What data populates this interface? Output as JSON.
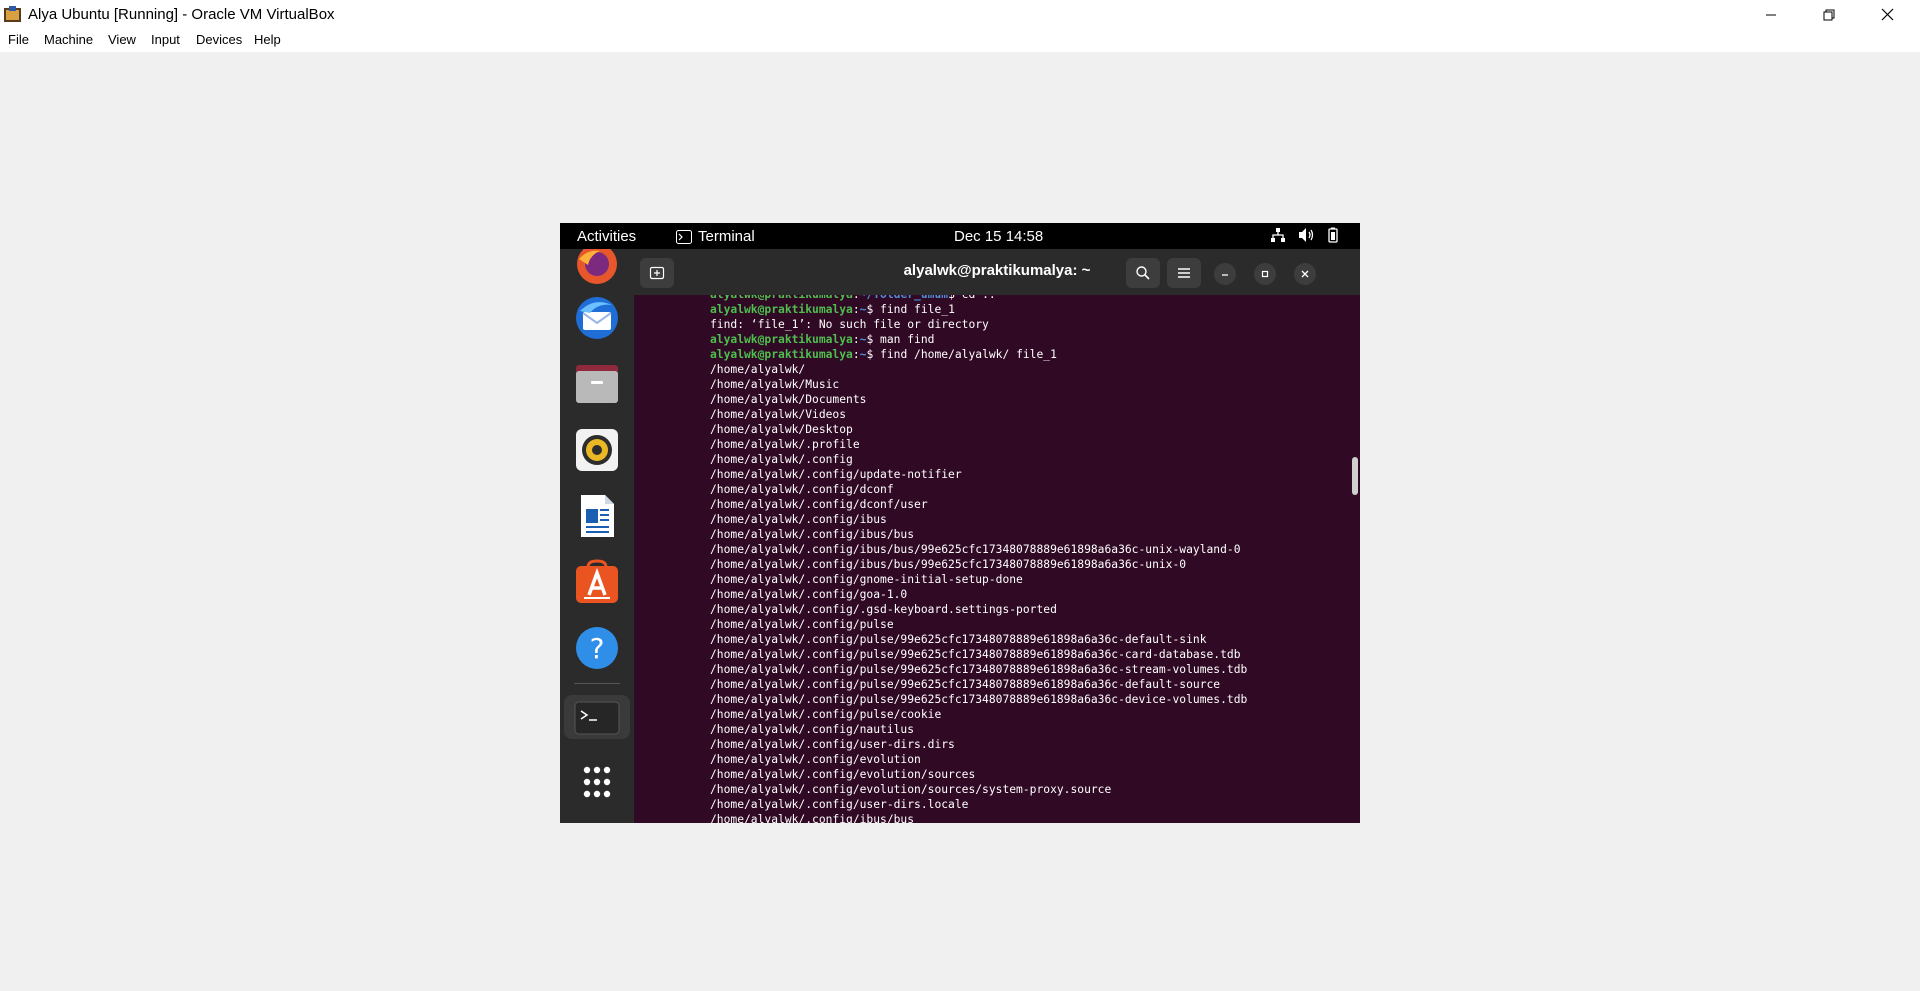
{
  "window": {
    "title": "Alya Ubuntu [Running] - Oracle VM VirtualBox",
    "controls": {
      "minimize_icon": "minimize-icon",
      "restore_icon": "restore-icon",
      "close_icon": "close-icon"
    }
  },
  "menubar": {
    "items": [
      "File",
      "Machine",
      "View",
      "Input",
      "Devices",
      "Help"
    ]
  },
  "ubuntu": {
    "activities": "Activities",
    "app_name": "Terminal",
    "clock": "Dec 15  14:58",
    "tray_icons": [
      "network-icon",
      "volume-icon",
      "battery-icon"
    ]
  },
  "dock": {
    "apps": [
      "firefox-icon",
      "thunderbird-icon",
      "files-icon",
      "rhythmbox-icon",
      "libreoffice-writer-icon",
      "app-center-icon",
      "help-icon",
      "terminal-icon",
      "show-apps-icon"
    ]
  },
  "terminal": {
    "title": "alyalwk@praktikumalya: ~",
    "header_icons": [
      "new-tab-icon",
      "search-icon",
      "hamburger-menu-icon",
      "minimize-icon",
      "maximize-icon",
      "close-icon"
    ],
    "lines": [
      {
        "user": "alyalwk@praktikumalya",
        "path": "~/folder_umum",
        "text": "$ cd .."
      },
      {
        "user": "alyalwk@praktikumalya",
        "path": "~",
        "text": "$ find file_1"
      },
      {
        "text": "find: ‘file_1’: No such file or directory"
      },
      {
        "user": "alyalwk@praktikumalya",
        "path": "~",
        "text": "$ man find"
      },
      {
        "user": "alyalwk@praktikumalya",
        "path": "~",
        "text": "$ find /home/alyalwk/ file_1"
      },
      {
        "text": "/home/alyalwk/"
      },
      {
        "text": "/home/alyalwk/Music"
      },
      {
        "text": "/home/alyalwk/Documents"
      },
      {
        "text": "/home/alyalwk/Videos"
      },
      {
        "text": "/home/alyalwk/Desktop"
      },
      {
        "text": "/home/alyalwk/.profile"
      },
      {
        "text": "/home/alyalwk/.config"
      },
      {
        "text": "/home/alyalwk/.config/update-notifier"
      },
      {
        "text": "/home/alyalwk/.config/dconf"
      },
      {
        "text": "/home/alyalwk/.config/dconf/user"
      },
      {
        "text": "/home/alyalwk/.config/ibus"
      },
      {
        "text": "/home/alyalwk/.config/ibus/bus"
      },
      {
        "text": "/home/alyalwk/.config/ibus/bus/99e625cfc17348078889e61898a6a36c-unix-wayland-0"
      },
      {
        "text": "/home/alyalwk/.config/ibus/bus/99e625cfc17348078889e61898a6a36c-unix-0"
      },
      {
        "text": "/home/alyalwk/.config/gnome-initial-setup-done"
      },
      {
        "text": "/home/alyalwk/.config/goa-1.0"
      },
      {
        "text": "/home/alyalwk/.config/.gsd-keyboard.settings-ported"
      },
      {
        "text": "/home/alyalwk/.config/pulse"
      },
      {
        "text": "/home/alyalwk/.config/pulse/99e625cfc17348078889e61898a6a36c-default-sink"
      },
      {
        "text": "/home/alyalwk/.config/pulse/99e625cfc17348078889e61898a6a36c-card-database.tdb"
      },
      {
        "text": "/home/alyalwk/.config/pulse/99e625cfc17348078889e61898a6a36c-stream-volumes.tdb"
      },
      {
        "text": "/home/alyalwk/.config/pulse/99e625cfc17348078889e61898a6a36c-default-source"
      },
      {
        "text": "/home/alyalwk/.config/pulse/99e625cfc17348078889e61898a6a36c-device-volumes.tdb"
      },
      {
        "text": "/home/alyalwk/.config/pulse/cookie"
      },
      {
        "text": "/home/alyalwk/.config/nautilus"
      },
      {
        "text": "/home/alyalwk/.config/user-dirs.dirs"
      },
      {
        "text": "/home/alyalwk/.config/evolution"
      },
      {
        "text": "/home/alyalwk/.config/evolution/sources"
      },
      {
        "text": "/home/alyalwk/.config/evolution/sources/system-proxy.source"
      },
      {
        "text": "/home/alyalwk/.config/user-dirs.locale"
      },
      {
        "text": "/home/alyalwk/.config/ibus/bus"
      }
    ]
  }
}
